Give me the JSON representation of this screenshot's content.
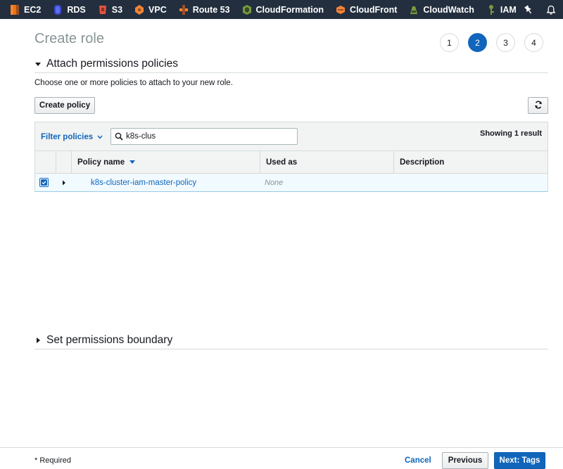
{
  "nav": {
    "services": [
      {
        "label": "EC2",
        "icon": "ec2-icon",
        "color": "#ec7211"
      },
      {
        "label": "RDS",
        "icon": "rds-icon",
        "color": "#3b48cc"
      },
      {
        "label": "S3",
        "icon": "s3-icon",
        "color": "#e25444"
      },
      {
        "label": "VPC",
        "icon": "vpc-icon",
        "color": "#f58536"
      },
      {
        "label": "Route 53",
        "icon": "route53-icon",
        "color": "#f58536"
      },
      {
        "label": "CloudFormation",
        "icon": "cloudformation-icon",
        "color": "#759c3e"
      },
      {
        "label": "CloudFront",
        "icon": "cloudfront-icon",
        "color": "#f58536"
      },
      {
        "label": "CloudWatch",
        "icon": "cloudwatch-icon",
        "color": "#759c3e"
      },
      {
        "label": "IAM",
        "icon": "iam-icon",
        "color": "#759c3e"
      }
    ],
    "pin_icon": "pin-icon",
    "bell_icon": "bell-icon"
  },
  "header": {
    "title": "Create role",
    "steps": [
      "1",
      "2",
      "3",
      "4"
    ],
    "active_step": "2"
  },
  "attach_section": {
    "title": "Attach permissions policies",
    "description": "Choose one or more policies to attach to your new role.",
    "create_policy_label": "Create policy",
    "refresh_icon": "refresh-icon"
  },
  "table": {
    "filter_label": "Filter policies",
    "search_value": "k8s-clus",
    "result_count": "Showing 1 result",
    "columns": [
      "Policy name",
      "Used as",
      "Description"
    ],
    "rows": [
      {
        "selected": true,
        "policy_name": "k8s-cluster-iam-master-policy",
        "used_as": "None",
        "description": ""
      }
    ]
  },
  "boundary_section": {
    "title": "Set permissions boundary"
  },
  "footer": {
    "required_note": "* Required",
    "cancel_label": "Cancel",
    "previous_label": "Previous",
    "next_label": "Next: Tags"
  },
  "colors": {
    "nav_bg": "#232f3e",
    "accent": "#1166bb",
    "row_selected_bg": "#f1faff"
  }
}
